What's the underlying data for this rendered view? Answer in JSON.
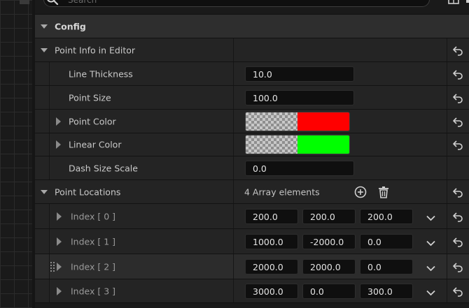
{
  "search": {
    "placeholder": "Search"
  },
  "sections": {
    "config": {
      "label": "Config"
    },
    "point_info": {
      "label": "Point Info in Editor"
    },
    "point_locations": {
      "label": "Point Locations",
      "count_text": "4 Array elements"
    }
  },
  "properties": {
    "line_thickness": {
      "label": "Line Thickness",
      "value": "10.0"
    },
    "point_size": {
      "label": "Point Size",
      "value": "100.0"
    },
    "point_color": {
      "label": "Point Color",
      "color": "#ff0000"
    },
    "linear_color": {
      "label": "Linear Color",
      "color": "#00ff00"
    },
    "dash_size_scale": {
      "label": "Dash Size Scale",
      "value": "0.0"
    }
  },
  "array_items": [
    {
      "label": "Index [ 0 ]",
      "x": "200.0",
      "y": "200.0",
      "z": "200.0"
    },
    {
      "label": "Index [ 1 ]",
      "x": "1000.0",
      "y": "-2000.0",
      "z": "0.0"
    },
    {
      "label": "Index [ 2 ]",
      "x": "2000.0",
      "y": "2000.0",
      "z": "0.0"
    },
    {
      "label": "Index [ 3 ]",
      "x": "3000.0",
      "y": "0.0",
      "z": "300.0"
    }
  ],
  "icons": {
    "search": "search-icon",
    "settings": "settings-icon",
    "reset": "reset-to-default-icon",
    "add": "add-element-icon",
    "delete": "delete-all-icon",
    "expand": "chevron-down-icon"
  }
}
